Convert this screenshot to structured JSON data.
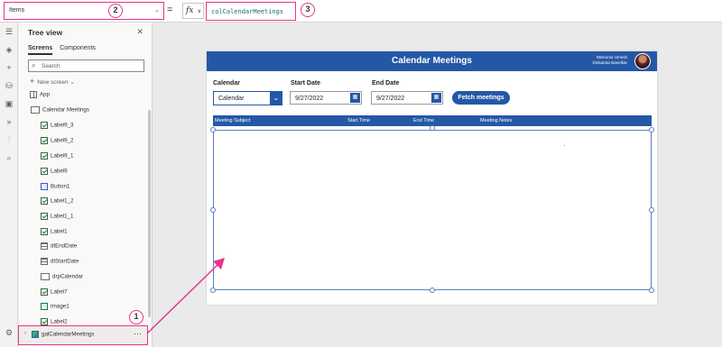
{
  "formula_bar": {
    "property": "Items",
    "equals": "=",
    "fx": "fx",
    "fx_chevron": "∨",
    "formula": "colCalendarMeetings"
  },
  "annotations": [
    "1",
    "2",
    "3"
  ],
  "rail_icons": [
    "hamburger-icon",
    "layers-icon",
    "add-icon",
    "database-icon",
    "media-icon",
    "power-automate-icon",
    "variables-icon",
    "search-icon",
    "settings-icon"
  ],
  "tree_view": {
    "title": "Tree view",
    "tabs": [
      "Screens",
      "Components"
    ],
    "search_placeholder": "Search",
    "new_screen": "New screen",
    "nodes": [
      {
        "label": "App",
        "icon": "app"
      },
      {
        "label": "Calendar Meetings",
        "icon": "scr"
      },
      {
        "label": "Label9_3",
        "icon": "chk"
      },
      {
        "label": "Label9_2",
        "icon": "chk"
      },
      {
        "label": "Label9_1",
        "icon": "chk"
      },
      {
        "label": "Label9",
        "icon": "chk"
      },
      {
        "label": "Button1",
        "icon": "btn"
      },
      {
        "label": "Label1_2",
        "icon": "chk"
      },
      {
        "label": "Label1_1",
        "icon": "chk"
      },
      {
        "label": "Label1",
        "icon": "chk"
      },
      {
        "label": "dtEndDate",
        "icon": "grid"
      },
      {
        "label": "dtStartDate",
        "icon": "grid"
      },
      {
        "label": "drpCalendar",
        "icon": "scr"
      },
      {
        "label": "Label7",
        "icon": "chk"
      },
      {
        "label": "Image1",
        "icon": "img"
      },
      {
        "label": "Label2",
        "icon": "chk"
      }
    ],
    "selected": "galCalendarMeetings",
    "more": "···"
  },
  "app": {
    "title": "Calendar Meetings",
    "welcome_line1": "Welcome Umesh",
    "welcome_line2": "Dinkarrao Banelkar",
    "calendar_label": "Calendar",
    "calendar_value": "Calendar",
    "start_label": "Start Date",
    "start_value": "9/27/2022",
    "end_label": "End Date",
    "end_value": "9/27/2022",
    "fetch_button": "Fetch meetings",
    "columns": [
      "Meeting Subject",
      "Start Time",
      "End Time",
      "Meeting Notes"
    ]
  },
  "colors": {
    "brand_blue": "#2458a6",
    "annotation_pink": "#e8348a"
  }
}
